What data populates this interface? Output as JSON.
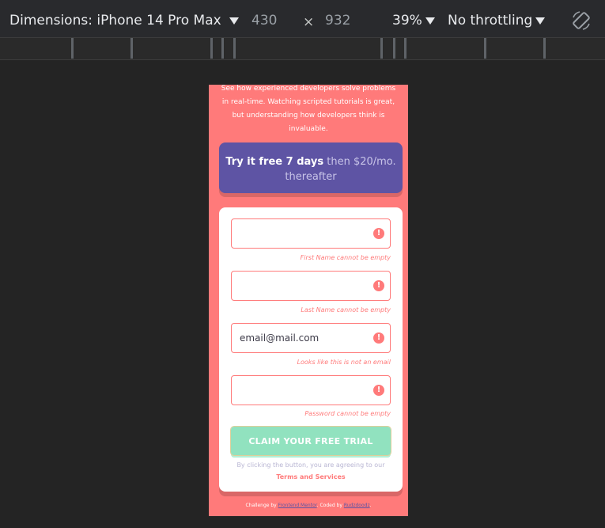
{
  "toolbar": {
    "dimensions_label": "Dimensions: iPhone 14 Pro Max",
    "width": "430",
    "times": "×",
    "height": "932",
    "zoom": "39%",
    "throttling": "No throttling",
    "rotate_icon": "rotate-icon"
  },
  "page": {
    "intro": "See how experienced developers solve problems in real-time. Watching scripted tutorials is great, but understanding how developers think is invaluable.",
    "promo_bold": "Try it free 7 days",
    "promo_rest": "then $20/mo. thereafter",
    "form": {
      "first_name": {
        "value": "",
        "error": "First Name cannot be empty"
      },
      "last_name": {
        "value": "",
        "error": "Last Name cannot be empty"
      },
      "email": {
        "value": "email@mail.com",
        "error": "Looks like this is not an email"
      },
      "password": {
        "value": "",
        "error": "Password cannot be empty"
      },
      "error_icon": "!",
      "submit_label": "CLAIM YOUR FREE TRIAL",
      "terms_text": "By clicking the button, you are agreeing to our",
      "terms_link": "Terms and Services"
    },
    "footer": {
      "challenge_by": "Challenge by",
      "fm_link": "Frontend Mentor",
      "coded_by": ". Coded by",
      "author_link": "Rudzdoodz",
      "end": "."
    }
  },
  "colors": {
    "background": "#ff7a7a",
    "promo": "#5e54a4",
    "accent_green": "#38cc8c"
  }
}
